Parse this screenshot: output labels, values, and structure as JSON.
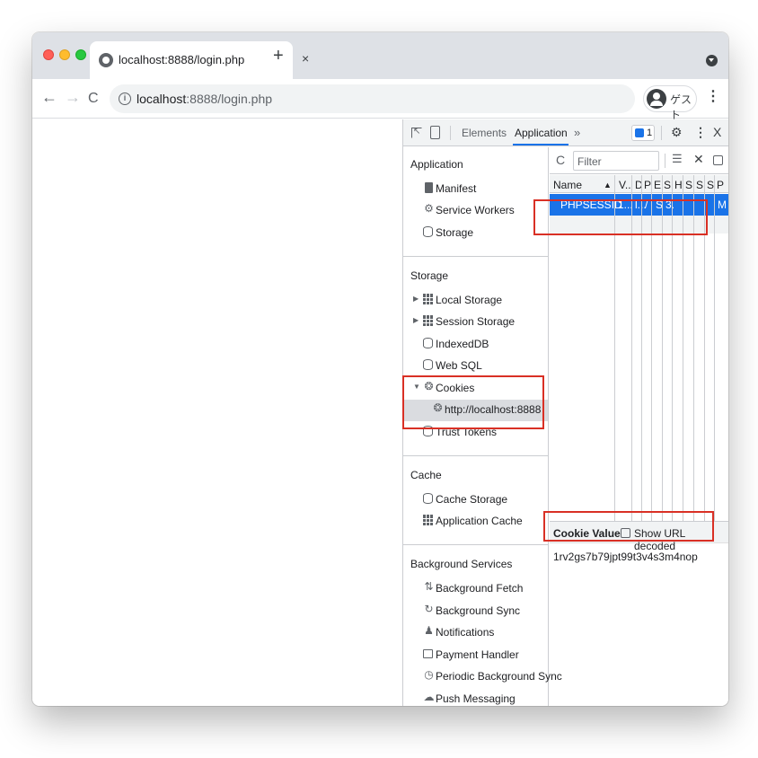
{
  "browser": {
    "tab_title": "localhost:8888/login.php",
    "tab_close": "×",
    "new_tab": "+",
    "url_host": "localhost",
    "url_rest": ":8888/login.php",
    "info_glyph": "i",
    "guest_label": "ゲスト",
    "menu_glyph": "⋮",
    "back_glyph": "←",
    "forward_glyph": "→",
    "reload_glyph": "C"
  },
  "devtools": {
    "tabs": {
      "elements": "Elements",
      "application": "Application",
      "more": "»"
    },
    "issues_count": "1",
    "close_glyph": "X",
    "sidebar": {
      "application": {
        "title": "Application",
        "items": [
          {
            "label": "Manifest",
            "icon": "document-icon"
          },
          {
            "label": "Service Workers",
            "icon": "gear-icon"
          },
          {
            "label": "Storage",
            "icon": "database-icon"
          }
        ]
      },
      "storage": {
        "title": "Storage",
        "items": [
          {
            "label": "Local Storage",
            "icon": "grid-icon"
          },
          {
            "label": "Session Storage",
            "icon": "grid-icon"
          },
          {
            "label": "IndexedDB",
            "icon": "database-icon"
          },
          {
            "label": "Web SQL",
            "icon": "database-icon"
          },
          {
            "label": "Cookies",
            "icon": "cookie-icon"
          },
          {
            "label": "http://localhost:8888",
            "icon": "cookie-icon"
          },
          {
            "label": "Trust Tokens",
            "icon": "database-icon"
          }
        ]
      },
      "cache": {
        "title": "Cache",
        "items": [
          {
            "label": "Cache Storage",
            "icon": "database-icon"
          },
          {
            "label": "Application Cache",
            "icon": "grid-icon"
          }
        ]
      },
      "background": {
        "title": "Background Services",
        "items": [
          {
            "label": "Background Fetch",
            "icon": "arrows-icon"
          },
          {
            "label": "Background Sync",
            "icon": "sync-icon"
          },
          {
            "label": "Notifications",
            "icon": "bell-icon"
          },
          {
            "label": "Payment Handler",
            "icon": "card-icon"
          },
          {
            "label": "Periodic Background Sync",
            "icon": "clock-icon"
          },
          {
            "label": "Push Messaging",
            "icon": "cloud-icon"
          }
        ]
      }
    },
    "cookies": {
      "filter_placeholder": "Filter",
      "columns": [
        "Name",
        "▲",
        "V..",
        "D",
        "P",
        "E",
        "S",
        "H",
        "S",
        "S",
        "S",
        "P"
      ],
      "row": {
        "name": "PHPSESSID",
        "value": "1...",
        "domain": "l...",
        "path": "/",
        "expires": "S",
        "size": "3.",
        "priority": "M"
      },
      "cookie_value_title": "Cookie Value",
      "show_url_decoded": "Show URL decoded",
      "cookie_value": "1rv2gs7b79jpt99t3v4s3m4nop"
    }
  },
  "colors": {
    "accent": "#1a73e8",
    "highlight": "#d93025"
  }
}
